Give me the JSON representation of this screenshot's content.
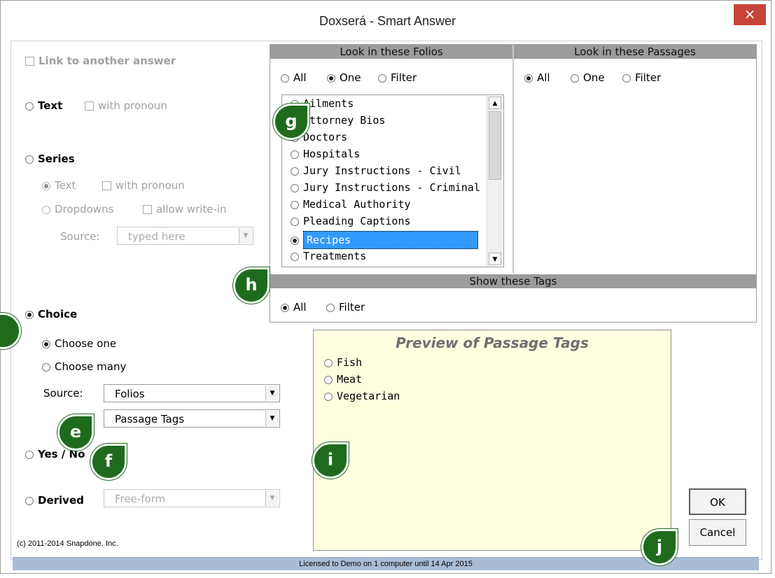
{
  "window": {
    "title": "Doxserá - Smart Answer",
    "close_glyph": "×"
  },
  "left": {
    "link_label": "Link to another answer",
    "text_label": "Text",
    "text_pronoun": "with pronoun",
    "series_label": "Series",
    "series_text": "Text",
    "series_pronoun": "with pronoun",
    "series_dropdowns": "Dropdowns",
    "series_writein": "allow write-in",
    "source_label": "Source:",
    "source_value": "typed here",
    "choice_label": "Choice",
    "choose_one": "Choose one",
    "choose_many": "Choose many",
    "choice_source_label": "Source:",
    "choice_source_value": "Folios",
    "choice_source2_value": "Passage Tags",
    "yesno_label": "Yes / No",
    "derived_label": "Derived",
    "derived_value": "Free-form",
    "copyright": "(c) 2011-2014 Snapdone, Inc."
  },
  "folios": {
    "header": "Look in these Folios",
    "opt_all": "All",
    "opt_one": "One",
    "opt_filter": "Filter",
    "selected_mode": "One",
    "items": [
      "Ailments",
      "Attorney Bios",
      "Doctors",
      "Hospitals",
      "Jury Instructions - Civil",
      "Jury Instructions - Criminal",
      "Medical Authority",
      "Pleading Captions",
      "Recipes",
      "Treatments"
    ],
    "selected_item": "Recipes"
  },
  "passages": {
    "header": "Look in these Passages",
    "opt_all": "All",
    "opt_one": "One",
    "opt_filter": "Filter",
    "selected_mode": "All"
  },
  "tags": {
    "header": "Show these Tags",
    "opt_all": "All",
    "opt_filter": "Filter",
    "selected_mode": "All"
  },
  "preview": {
    "title": "Preview of Passage Tags",
    "items": [
      "Fish",
      "Meat",
      "Vegetarian"
    ]
  },
  "buttons": {
    "ok": "OK",
    "cancel": "Cancel"
  },
  "status": "Licensed to Demo on 1 computer until 14 Apr 2015",
  "callouts": [
    "e",
    "f",
    "g",
    "h",
    "i",
    "j"
  ],
  "colors": {
    "callout": "#1e6b1e",
    "selection": "#3399ff",
    "preview_bg": "#ffffe0",
    "status_bg": "#a8bcd6",
    "close_bg": "#c7443a"
  }
}
